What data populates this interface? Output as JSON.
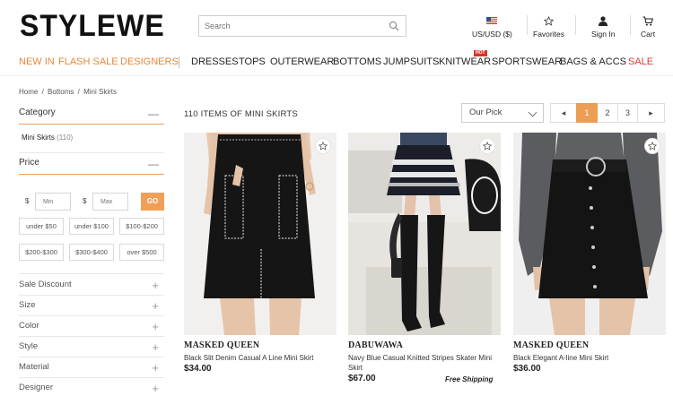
{
  "header": {
    "logo": "STYLEWE",
    "search_placeholder": "Search",
    "currency": "US/USD ($)",
    "favorites": "Favorites",
    "signin": "Sign In",
    "cart": "Cart"
  },
  "nav": {
    "highlight": [
      "NEW IN",
      "FLASH SALE",
      "DESIGNERS"
    ],
    "items": [
      "DRESSES",
      "TOPS",
      "OUTERWEAR",
      "BOTTOMS",
      "JUMPSUITS",
      "KNITWEAR",
      "SPORTSWEAR",
      "BAGS & ACCS"
    ],
    "sale": "SALE",
    "hot_badge": "HOT"
  },
  "breadcrumb": [
    "Home",
    "/",
    "Bottoms",
    "/",
    "Mini Skirts"
  ],
  "sidebar": {
    "category_title": "Category",
    "category_item": "Mini Skirts",
    "category_count": "(110)",
    "price_title": "Price",
    "currency_symbol": "$",
    "min_placeholder": "Min",
    "max_placeholder": "Max",
    "go_label": "GO",
    "price_ranges": [
      "under $50",
      "under $100",
      "$100-$200",
      "$200-$300",
      "$300-$400",
      "over $500"
    ],
    "filters": [
      "Sale Discount",
      "Size",
      "Color",
      "Style",
      "Material",
      "Designer"
    ]
  },
  "listing": {
    "count": "110 ITEMS OF MINI SKIRTS",
    "sort": "Our Pick",
    "pages": [
      "1",
      "2",
      "3"
    ],
    "current_page": "1",
    "prev": "◂",
    "next": "▸"
  },
  "products": [
    {
      "brand": "MASKED QUEEN",
      "name": "Black Slit Denim Casual A Line Mini Skirt",
      "price": "$34.00"
    },
    {
      "brand": "DABUWAWA",
      "name": "Navy Blue Casual Knitted Stripes Skater Mini Skirt",
      "price": "$67.00",
      "shipping": "Free Shipping"
    },
    {
      "brand": "MASKED QUEEN",
      "name": "Black Elegant A-line Mini Skirt",
      "price": "$36.00"
    }
  ],
  "colors": {
    "accent": "#ee9d54",
    "sale": "#e53935",
    "hot": "#d9342b"
  }
}
